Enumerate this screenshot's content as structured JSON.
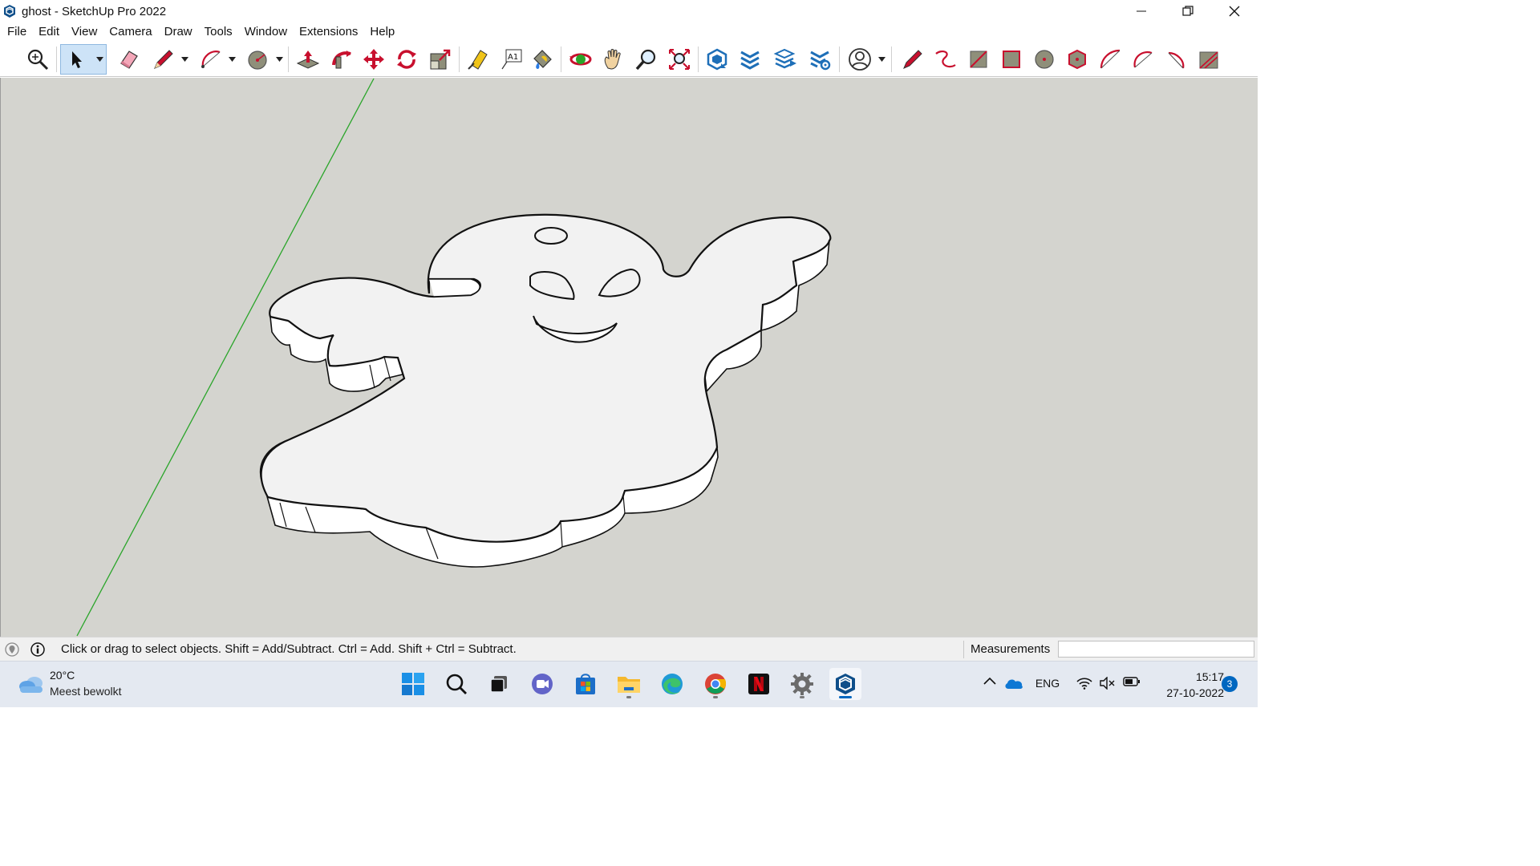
{
  "window": {
    "title": "ghost - SketchUp Pro 2022"
  },
  "menu": [
    "File",
    "Edit",
    "View",
    "Camera",
    "Draw",
    "Tools",
    "Window",
    "Extensions",
    "Help"
  ],
  "toolbar": {
    "tools": [
      "zoom-search-icon",
      "select-icon",
      "eraser-icon",
      "pencil-line-icon",
      "arc-icon",
      "shape-icon",
      "push-pull-icon",
      "follow-me-icon",
      "move-icon",
      "rotate-icon",
      "scale-icon",
      "tape-measure-icon",
      "text-icon",
      "paint-bucket-icon",
      "orbit-icon",
      "pan-icon",
      "zoom-icon",
      "zoom-extents-icon",
      "warehouse-icon",
      "extension-warehouse-icon",
      "layout-icon",
      "extension-manager-icon",
      "account-icon",
      "freehand-icon",
      "curve-icon",
      "rectangle-icon",
      "rotated-rect-icon",
      "circle-icon",
      "polygon-icon",
      "arc-2pt-icon",
      "arc-3pt-icon",
      "pie-icon",
      "sandbox-icon"
    ],
    "active_tool": "select-icon"
  },
  "status": {
    "hint": "Click or drag to select objects. Shift = Add/Subtract. Ctrl = Add. Shift + Ctrl = Subtract.",
    "measurements_label": "Measurements",
    "measurements_value": ""
  },
  "taskbar": {
    "weather_temp": "20°C",
    "weather_desc": "Meest bewolkt",
    "apps": [
      "start-icon",
      "search-icon",
      "task-view-icon",
      "teams-icon",
      "store-icon",
      "file-explorer-icon",
      "edge-icon",
      "chrome-icon",
      "netflix-icon",
      "settings-icon",
      "sketchup-icon"
    ],
    "active_app": "sketchup-icon",
    "language": "ENG",
    "time": "15:17",
    "date": "27-10-2022",
    "notifications": "3"
  },
  "colors": {
    "viewport_bg": "#d4d4cf",
    "green_axis": "#2aa52a",
    "face": "#f2f2f2",
    "accent": "#0067c0",
    "tool_red": "#c8102e"
  }
}
